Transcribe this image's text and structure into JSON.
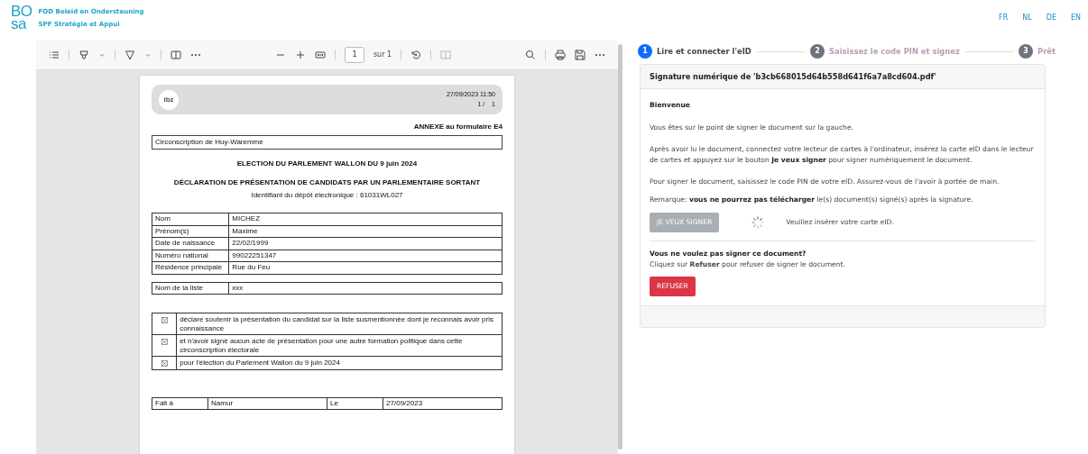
{
  "header": {
    "logo": {
      "top": "BO",
      "bottom": "sa"
    },
    "org_lines": [
      "FOD Beleid en Ondersteuning",
      "SPF Stratégie et Appui"
    ],
    "languages": [
      "FR",
      "NL",
      "DE",
      "EN"
    ]
  },
  "viewer": {
    "toolbar": {
      "page": "1",
      "page_total": "sur 1"
    },
    "document": {
      "logo": "ibz",
      "timestamp": "27/09/2023 11:50",
      "page_counter": "1 /    1",
      "annex": "ANNEXE au formulaire E4",
      "district": "Circonscription de Huy-Waremme",
      "title": "ELECTION DU PARLEMENT WALLON DU 9 juin 2024",
      "subtitle": "DÉCLARATION DE PRÉSENTATION DE CANDIDATS PAR UN PARLEMENTAIRE SORTANT",
      "identifier": "Identifiant du dépôt électronique : 61031WL027",
      "person": [
        {
          "label": "Nom",
          "value": "MICHEZ"
        },
        {
          "label": "Prénom(s)",
          "value": "Maxime"
        },
        {
          "label": "Date de naissance",
          "value": "22/02/1999"
        },
        {
          "label": "Numéro national",
          "value": "99022251347"
        },
        {
          "label": "Résidence principale",
          "value": "Rue du Feu"
        }
      ],
      "list": {
        "label": "Nom de la liste",
        "value": "xxx"
      },
      "declarations": [
        {
          "text": "déclare soutenir la présentation du candidat sur la liste susmentionnée dont je reconnais avoir pris connaissance",
          "checked": true
        },
        {
          "text": "et n'avoir signé aucun acte de présentation pour une autre formation politique dans cette circonscription électorale",
          "checked": true
        },
        {
          "text": "pour l'élection du Parlement Wallon du 9 juin 2024",
          "checked": true
        }
      ],
      "footer": [
        "Fait à",
        "Namur",
        "Le",
        "27/09/2023"
      ]
    }
  },
  "steps": [
    {
      "number": "1",
      "label": "Lire et connecter l'eID",
      "active": true
    },
    {
      "number": "2",
      "label": "Saisissez le code PIN et signez",
      "active": false
    },
    {
      "number": "3",
      "label": "Prêt",
      "active": false
    }
  ],
  "card": {
    "title": "Signature numérique de 'b3cb668015d64b558d641f6a7a8cd604.pdf'",
    "heading": "Bienvenue",
    "paragraphs": [
      "Vous êtes sur le point de signer le document sur la gauche.",
      "Après avoir lu le document, connectez votre lecteur de cartes à l'ordinateur, insérez la carte eID dans le lecteur de cartes et appuyez sur le bouton **Je veux signer** pour signer numériquement le document.",
      "Pour signer le document, saisissez le code PIN de votre eID. Assurez-vous de l'avoir à portée de main.",
      "Remarque: **vous ne pourrez pas télécharger** le(s) document(s) signé(s) après la signature."
    ],
    "sign_button": {
      "label": "JE VEUX SIGNER",
      "disabled": true
    },
    "status": "Veuillez insérer votre carte eID.",
    "refuse_heading": "Vous ne voulez pas signer ce document?",
    "refuse_text": "Cliquez sur **Refuser** pour refuser de signer le document.",
    "refuse_button": "REFUSER"
  }
}
